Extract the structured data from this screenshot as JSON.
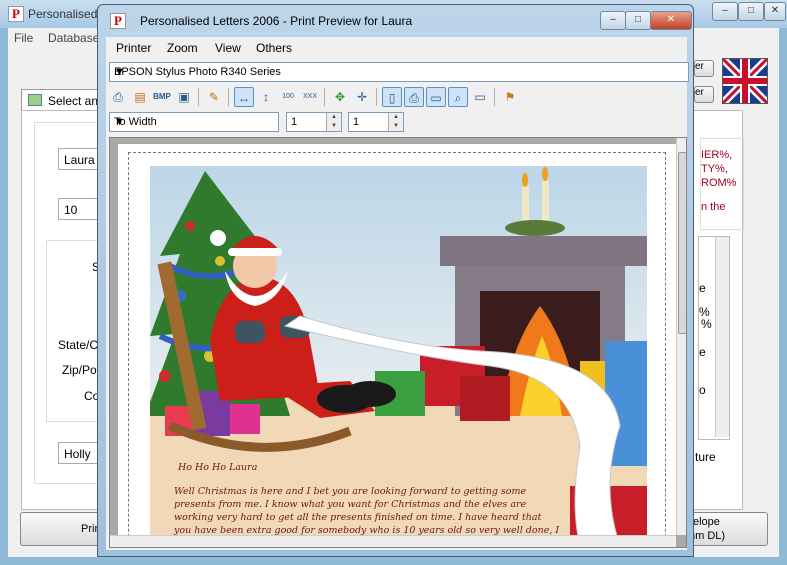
{
  "main_window": {
    "title": "Personalised",
    "menu": [
      "File",
      "Database"
    ],
    "tab_label": "Select an",
    "fields": {
      "first_name": "Laura",
      "age": "10",
      "other_name": "Holly"
    },
    "labels": {
      "s": "S",
      "state": "State/Co",
      "zip": "Zip/Pos",
      "co": "Co"
    },
    "right_buttons": [
      "er",
      "er"
    ],
    "tokens": [
      "IER%,",
      "TY%,",
      "ROM%",
      "n the"
    ],
    "right_labels": [
      "e",
      "%",
      "%",
      "e",
      "o",
      "ture"
    ],
    "bottom_buttons": {
      "left": "Prin",
      "right_line1": "elope",
      "right_line2": "nm DL)"
    }
  },
  "preview_window": {
    "title": "Personalised Letters 2006 - Print Preview for Laura",
    "menu": [
      "Printer",
      "Zoom",
      "View",
      "Others"
    ],
    "printer": "EPSON Stylus Photo R340 Series",
    "zoom_mode": "To Width",
    "page_from": "1",
    "page_to": "1"
  },
  "letter": {
    "greeting": "Ho Ho Ho Laura",
    "line1": "Well Christmas is here and I bet you are looking forward to getting some",
    "line2": "presents from me.  I know what you want for Christmas and the elves are",
    "line3": "working very hard to get all the presents finished on time.  I have heard that",
    "line4": "you have been extra good for somebody who is 10 years old so very well done, I"
  },
  "colors": {
    "title_bar": "#bcd5ea",
    "letter_text": "#6b1a0e",
    "santa_red": "#cc1f1a"
  }
}
